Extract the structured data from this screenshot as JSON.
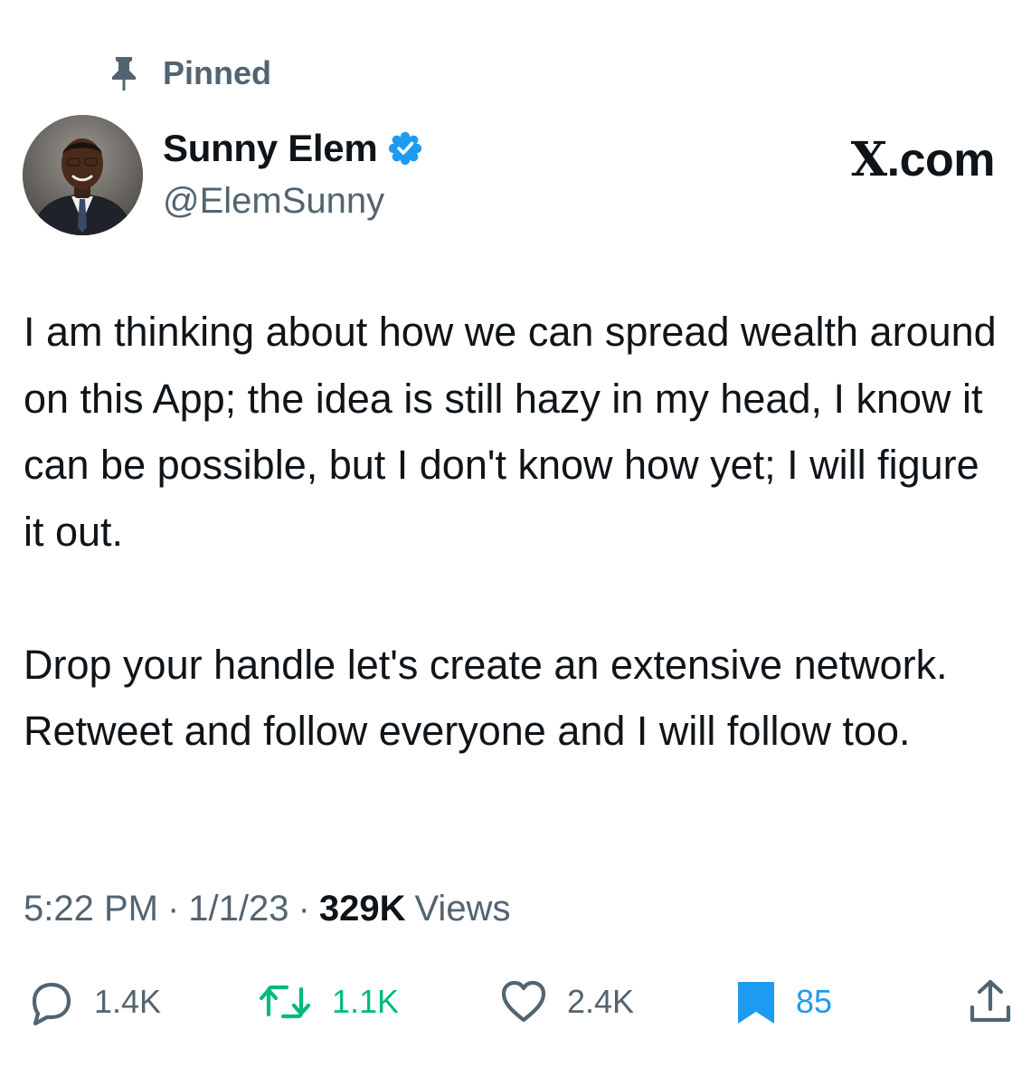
{
  "pinned": {
    "label": "Pinned",
    "icon": "pin-icon"
  },
  "author": {
    "display_name": "Sunny Elem",
    "handle": "@ElemSunny",
    "verified_icon": "verified-badge-icon",
    "verified_color": "#1d9bf0"
  },
  "brand": {
    "x_letter": "X",
    "suffix": ".com"
  },
  "tweet": {
    "paragraphs": [
      "I am thinking about how we can spread wealth around on this App; the idea is still hazy in my head, I know it can be possible, but I don't know how yet; I will figure it out.",
      "Drop your handle let's create an extensive network. Retweet and follow everyone and I will follow too."
    ]
  },
  "meta": {
    "time": "5:22 PM",
    "sep1": "·",
    "date": "1/1/23",
    "sep2": "·",
    "views_count": "329K",
    "views_label": "Views"
  },
  "actions": {
    "reply": {
      "icon": "reply-icon",
      "count": "1.4K"
    },
    "retweet": {
      "icon": "retweet-icon",
      "count": "1.1K",
      "color": "#00ba7c"
    },
    "like": {
      "icon": "heart-icon",
      "count": "2.4K"
    },
    "bookmark": {
      "icon": "bookmark-icon",
      "count": "85",
      "color": "#1d9bf0"
    },
    "share": {
      "icon": "share-icon"
    }
  }
}
